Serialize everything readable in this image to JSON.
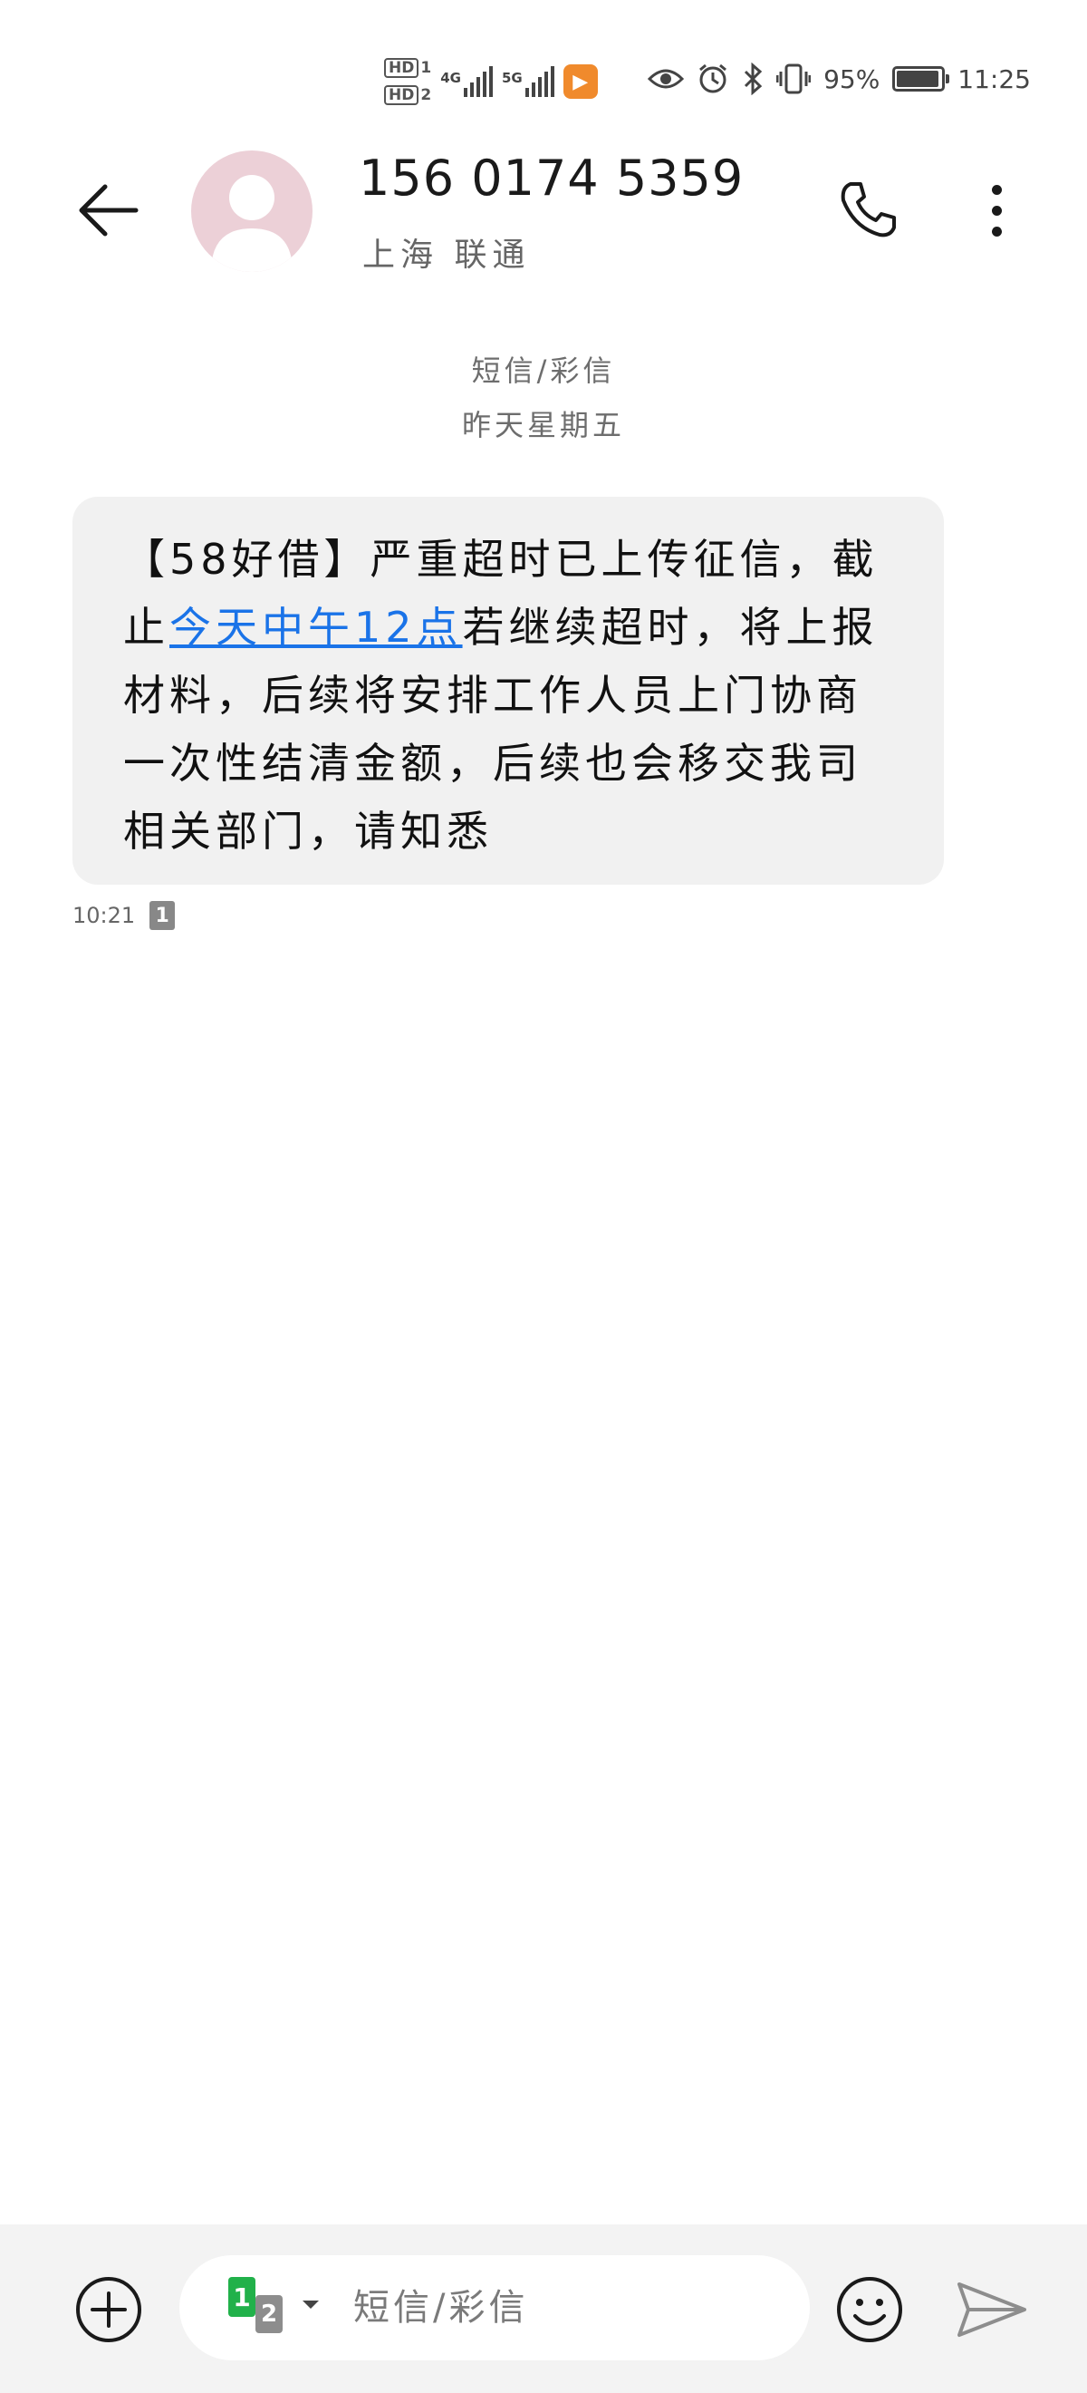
{
  "status_bar": {
    "hd1": "HD",
    "hd1_index": "1",
    "hd2": "HD",
    "hd2_index": "2",
    "network1": "4G",
    "network2": "5G",
    "battery_percent": "95%",
    "battery_level": 0.95,
    "time": "11:25",
    "icons": [
      "eye-icon",
      "alarm-icon",
      "bluetooth-icon",
      "vibrate-icon",
      "battery-icon"
    ]
  },
  "header": {
    "contact_number": "156 0174 5359",
    "contact_location": "上海 联通"
  },
  "thread": {
    "message_type": "短信/彩信",
    "date_label": "昨天星期五",
    "messages": [
      {
        "text_before": "【58好借】严重超时已上传征信，截止",
        "link_text": "今天中午12点",
        "text_after": "若继续超时，将上报材料，后续将安排工作人员上门协商一次性结清金额，后续也会移交我司相关部门，请知悉",
        "time": "10:21",
        "sim": "1"
      }
    ]
  },
  "input_bar": {
    "sim1": "1",
    "sim2": "2",
    "placeholder": "短信/彩信"
  },
  "colors": {
    "link": "#1a73e8",
    "bubble": "#f1f1f1",
    "avatar": "#ecd0d7",
    "sim1": "#21b14a",
    "app_badge": "#f08a2c"
  }
}
